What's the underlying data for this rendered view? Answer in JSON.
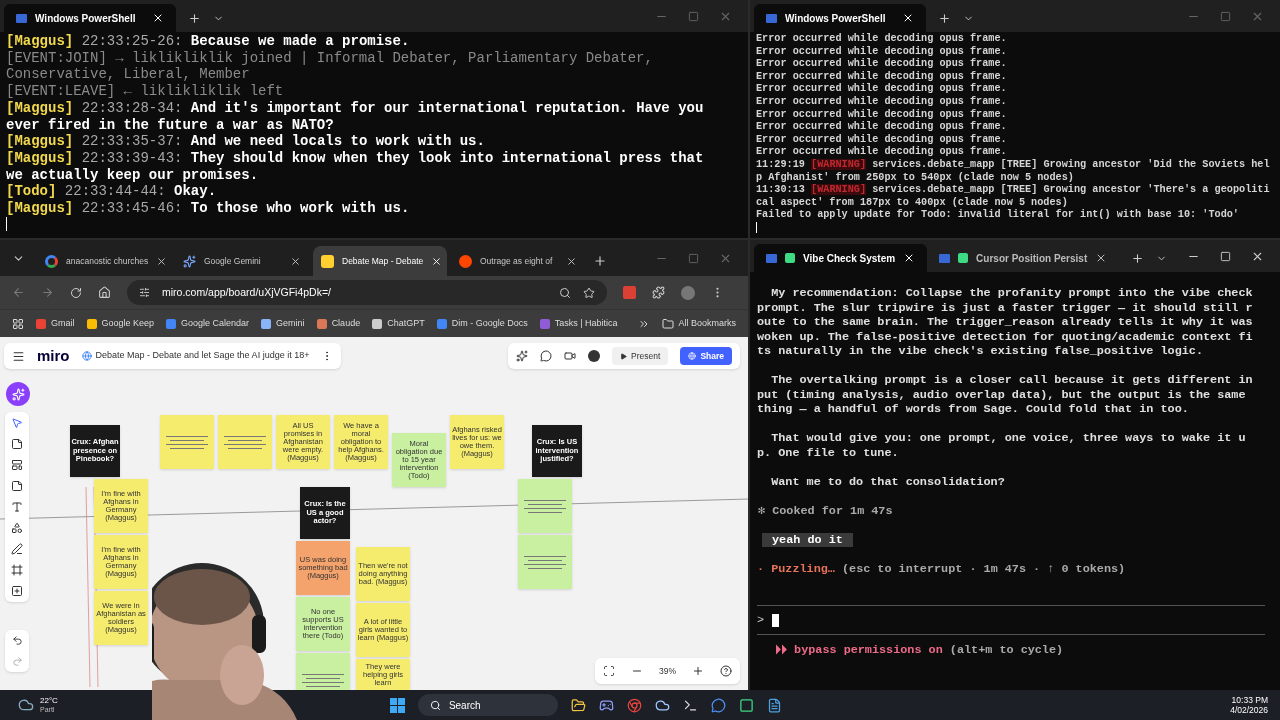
{
  "top_left_terminal": {
    "tabs": [
      {
        "title": "Windows PowerShell",
        "selected": true
      }
    ],
    "lines": [
      {
        "kind": "speech",
        "speaker": "[Maggus]",
        "time": "22:33:25-26:",
        "text": "Because we made a promise."
      },
      {
        "kind": "event",
        "text": "[EVENT:JOIN] → liklikliklik joined | Informal Debater, Parliamentary Debater, Conservative, Liberal, Member"
      },
      {
        "kind": "event",
        "text": "[EVENT:LEAVE] ← liklikliklik left"
      },
      {
        "kind": "speech",
        "speaker": "[Maggus]",
        "time": "22:33:28-34:",
        "text": "And it's important for our international reputation. Have you ever fired in the future a war as NATO?"
      },
      {
        "kind": "speech",
        "speaker": "[Maggus]",
        "time": "22:33:35-37:",
        "text": "And we need locals to work with us."
      },
      {
        "kind": "speech",
        "speaker": "[Maggus]",
        "time": "22:33:39-43:",
        "text": "They should know when they look into international press that we actually keep our promises."
      },
      {
        "kind": "speech",
        "speaker": "[Todo]",
        "time": "22:33:44-44:",
        "text": "Okay."
      },
      {
        "kind": "speech",
        "speaker": "[Maggus]",
        "time": "22:33:45-46:",
        "text": "To those who work with us."
      }
    ]
  },
  "top_right_terminal": {
    "tabs": [
      {
        "title": "Windows PowerShell",
        "selected": true
      }
    ],
    "lines": [
      {
        "kind": "plain",
        "text": "Error occurred while decoding opus frame."
      },
      {
        "kind": "plain",
        "text": "Error occurred while decoding opus frame."
      },
      {
        "kind": "plain",
        "text": "Error occurred while decoding opus frame."
      },
      {
        "kind": "plain",
        "text": "Error occurred while decoding opus frame."
      },
      {
        "kind": "plain",
        "text": "Error occurred while decoding opus frame."
      },
      {
        "kind": "plain",
        "text": "Error occurred while decoding opus frame."
      },
      {
        "kind": "plain",
        "text": "Error occurred while decoding opus frame."
      },
      {
        "kind": "plain",
        "text": "Error occurred while decoding opus frame."
      },
      {
        "kind": "plain",
        "text": "Error occurred while decoding opus frame."
      },
      {
        "kind": "plain",
        "text": "Error occurred while decoding opus frame."
      },
      {
        "kind": "log",
        "time": "11:29:19",
        "level": "[WARNING]",
        "text": "services.debate_mapp [TREE] Growing ancestor 'Did the Soviets help Afghanist' from 250px to 540px (clade now 5 nodes)"
      },
      {
        "kind": "log",
        "time": "11:30:13",
        "level": "[WARNING]",
        "text": "services.debate_mapp [TREE] Growing ancestor 'There's a geopolitical aspect' from 187px to 400px (clade now 5 nodes)"
      },
      {
        "kind": "plain",
        "text": "Failed to apply update for Todo: invalid literal for int() with base 10: 'Todo'"
      }
    ]
  },
  "browser": {
    "tabs": [
      {
        "title": "anacanostic churches",
        "selected": false
      },
      {
        "title": "Google Gemini",
        "selected": false
      },
      {
        "title": "Debate Map - Debate",
        "selected": true
      },
      {
        "title": "Outrage as eight of",
        "selected": false
      }
    ],
    "url": "miro.com/app/board/uXjVGFi4pDk=/",
    "bookmarks": [
      {
        "label": "Gmail",
        "color": "#ea4335"
      },
      {
        "label": "Google Keep",
        "color": "#fbbc04"
      },
      {
        "label": "Google Calendar",
        "color": "#4285f4"
      },
      {
        "label": "Gemini",
        "color": "#8ab4f8"
      },
      {
        "label": "Claude",
        "color": "#d97757"
      },
      {
        "label": "ChatGPT",
        "color": "#cccccc"
      },
      {
        "label": "Dim - Google Docs",
        "color": "#4285f4"
      },
      {
        "label": "Tasks | Habitica",
        "color": "#8f5bd6"
      }
    ],
    "all_bookmarks": "All Bookmarks"
  },
  "miro": {
    "logo": "miro",
    "board_title": "Debate Map - Debate and let Sage the AI judge it 18+",
    "present": "Present",
    "share": "Share",
    "zoom": "39%",
    "notes": [
      {
        "kind": "crux",
        "text": "Crux: Afghan presence on Pinebook?"
      },
      {
        "kind": "yellow"
      },
      {
        "kind": "yellow"
      },
      {
        "kind": "yellow",
        "text": "All US promises in Afghanistan were empty. (Maggus)"
      },
      {
        "kind": "yellow",
        "text": "We have a moral obligation to help Afghans. (Maggus)"
      },
      {
        "kind": "green",
        "text": "Moral obligation due to 15 year intervention (Todo)"
      },
      {
        "kind": "yellow",
        "text": "Afghans risked lives for us: we owe them. (Maggus)"
      },
      {
        "kind": "crux",
        "text": "Crux: Is US intervention justified?"
      },
      {
        "kind": "yellow",
        "text": "I'm fine with Afghans in Germany (Maggus)"
      },
      {
        "kind": "yellow",
        "text": "I'm fine with Afghans in Germany (Maggus)"
      },
      {
        "kind": "yellow",
        "text": "We were in Afghanistan as soldiers (Maggus)"
      },
      {
        "kind": "crux",
        "text": "Crux: Is the US a good actor?"
      },
      {
        "kind": "orange",
        "text": "US was doing something bad (Maggus)"
      },
      {
        "kind": "green",
        "text": "No one supports US intervention there (Todo)"
      },
      {
        "kind": "green"
      },
      {
        "kind": "yellow",
        "text": "Then we're not doing anything bad. (Maggus)"
      },
      {
        "kind": "yellow",
        "text": "A lot of little girls wanted to learn (Maggus)"
      },
      {
        "kind": "yellow",
        "text": "They were helping girls learn"
      },
      {
        "kind": "green"
      },
      {
        "kind": "green"
      }
    ]
  },
  "bottom_right_terminal": {
    "tabs": [
      {
        "title": "Vibe Check System",
        "selected": true
      },
      {
        "title": "Cursor Position Persist",
        "selected": false
      }
    ],
    "blocks": [
      {
        "kind": "paragraph",
        "text": "**My recommendation:** Collapse the profanity prompt into the vibe check prompt. The slur tripwire is just a faster trigger — it should still route to the same brain. The trigger_reason already tells it why it was woken up. The false-positive detection for quoting/academic context fits naturally in the vibe check's existing false_positive logic."
      },
      {
        "kind": "paragraph",
        "text": "The overtalking prompt is a closer call because it gets different input (timing analysis, audio overlap data), but the output is the same thing — a handful of words from Sage. Could fold that in too."
      },
      {
        "kind": "paragraph",
        "text": "That would give you: one prompt, one voice, three ways to wake it up. One file to tune."
      },
      {
        "kind": "paragraph",
        "text": "Want me to do that consolidation?"
      },
      {
        "kind": "status",
        "text": "✻ Cooked for 1m 47s"
      },
      {
        "kind": "user",
        "text": "yeah do it"
      },
      {
        "kind": "working",
        "verb": "· Puzzling…",
        "text": "(esc to interrupt · 1m 47s · ↑ 0 tokens)"
      },
      {
        "kind": "prompt",
        "text": ">"
      },
      {
        "kind": "mode",
        "text": "⏵⏵ bypass permissions on",
        "hint": "(alt+m to cycle)"
      }
    ]
  },
  "taskbar": {
    "weather": "22°C",
    "weather_caption": "Partl",
    "search": "Search",
    "time": "10:33 PM",
    "date": "4/02/2026"
  }
}
